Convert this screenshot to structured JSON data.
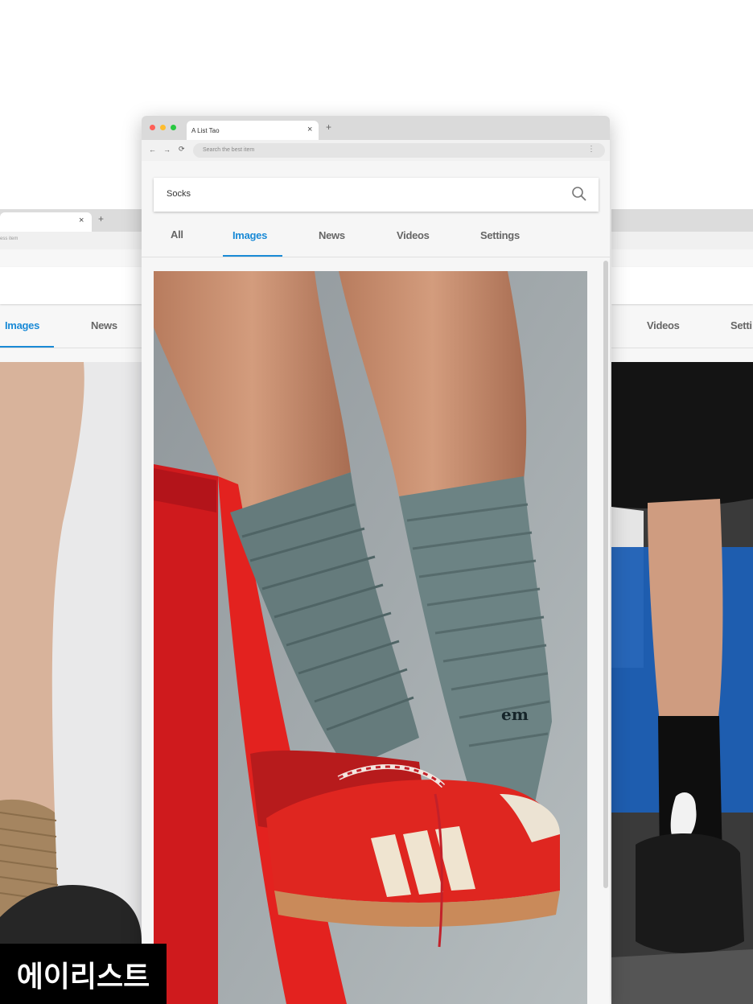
{
  "browser": {
    "tab_title": "A List Tao",
    "tab_close": "×",
    "new_tab": "+",
    "address_placeholder": "Search the best item",
    "menu_icon": "kebab-menu-icon"
  },
  "search": {
    "query": "Socks",
    "icon": "search-icon"
  },
  "tabs": [
    {
      "label": "All",
      "active": false
    },
    {
      "label": "Images",
      "active": true
    },
    {
      "label": "News",
      "active": false
    },
    {
      "label": "Videos",
      "active": false
    },
    {
      "label": "Settings",
      "active": false
    }
  ],
  "left_window": {
    "tab_close": "×",
    "new_tab": "+",
    "address_fragment": "ess item",
    "tabs": [
      {
        "label": "Images",
        "active": true
      },
      {
        "label": "News",
        "active": false
      }
    ]
  },
  "right_window": {
    "tabs": [
      {
        "label": "Videos",
        "active": false
      },
      {
        "label": "Setti",
        "active": false
      }
    ]
  },
  "photos": {
    "main": {
      "subject": "green ribbed socks with red sneakers on a red ladder",
      "sock_logo": "em"
    },
    "left": {
      "subject": "tan socks with black sneakers"
    },
    "right": {
      "subject": "black socks with rabbit print and black shoes"
    }
  },
  "brand_badge": "에이리스트",
  "colors": {
    "accent": "#1a8ad6",
    "traffic_red": "#ff5f57",
    "traffic_yellow": "#febc2e",
    "traffic_green": "#28c840",
    "badge_bg": "#000000"
  }
}
